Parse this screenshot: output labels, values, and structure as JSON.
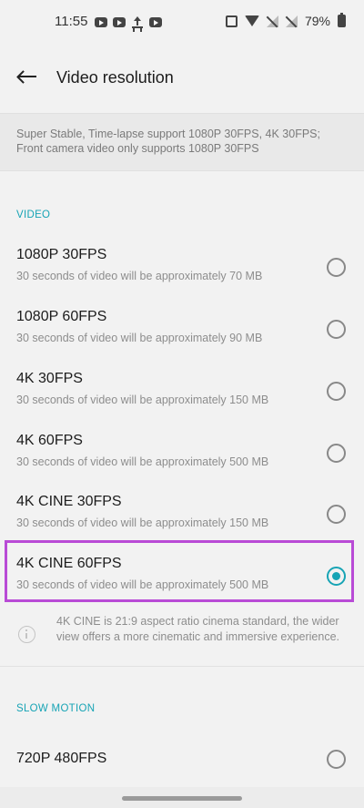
{
  "status_bar": {
    "time": "11:55",
    "battery_percent": "79%"
  },
  "header": {
    "title": "Video resolution"
  },
  "banner": {
    "text": "Super Stable, Time-lapse support 1080P 30FPS, 4K 30FPS; Front camera video only supports 1080P 30FPS"
  },
  "video_section": {
    "label": "VIDEO",
    "options": [
      {
        "name": "1080P 30FPS",
        "desc": "30 seconds of video will be approximately 70 MB",
        "selected": false
      },
      {
        "name": "1080P 60FPS",
        "desc": "30 seconds of video will be approximately 90 MB",
        "selected": false
      },
      {
        "name": "4K 30FPS",
        "desc": "30 seconds of video will be approximately 150 MB",
        "selected": false
      },
      {
        "name": "4K 60FPS",
        "desc": "30 seconds of video will be approximately 500 MB",
        "selected": false
      },
      {
        "name": "4K CINE 30FPS",
        "desc": "30 seconds of video will be approximately 150 MB",
        "selected": false
      },
      {
        "name": "4K CINE 60FPS",
        "desc": "30 seconds of video will be approximately 500 MB",
        "selected": true
      }
    ],
    "note": "4K CINE is 21:9 aspect ratio cinema standard, the wider view offers a more cinematic and immersive experience."
  },
  "slow_motion_section": {
    "label": "SLOW MOTION",
    "options": [
      {
        "name": "720P 480FPS",
        "selected": false
      }
    ]
  },
  "colors": {
    "accent": "#17a4b5",
    "highlight": "#b94bd6"
  }
}
